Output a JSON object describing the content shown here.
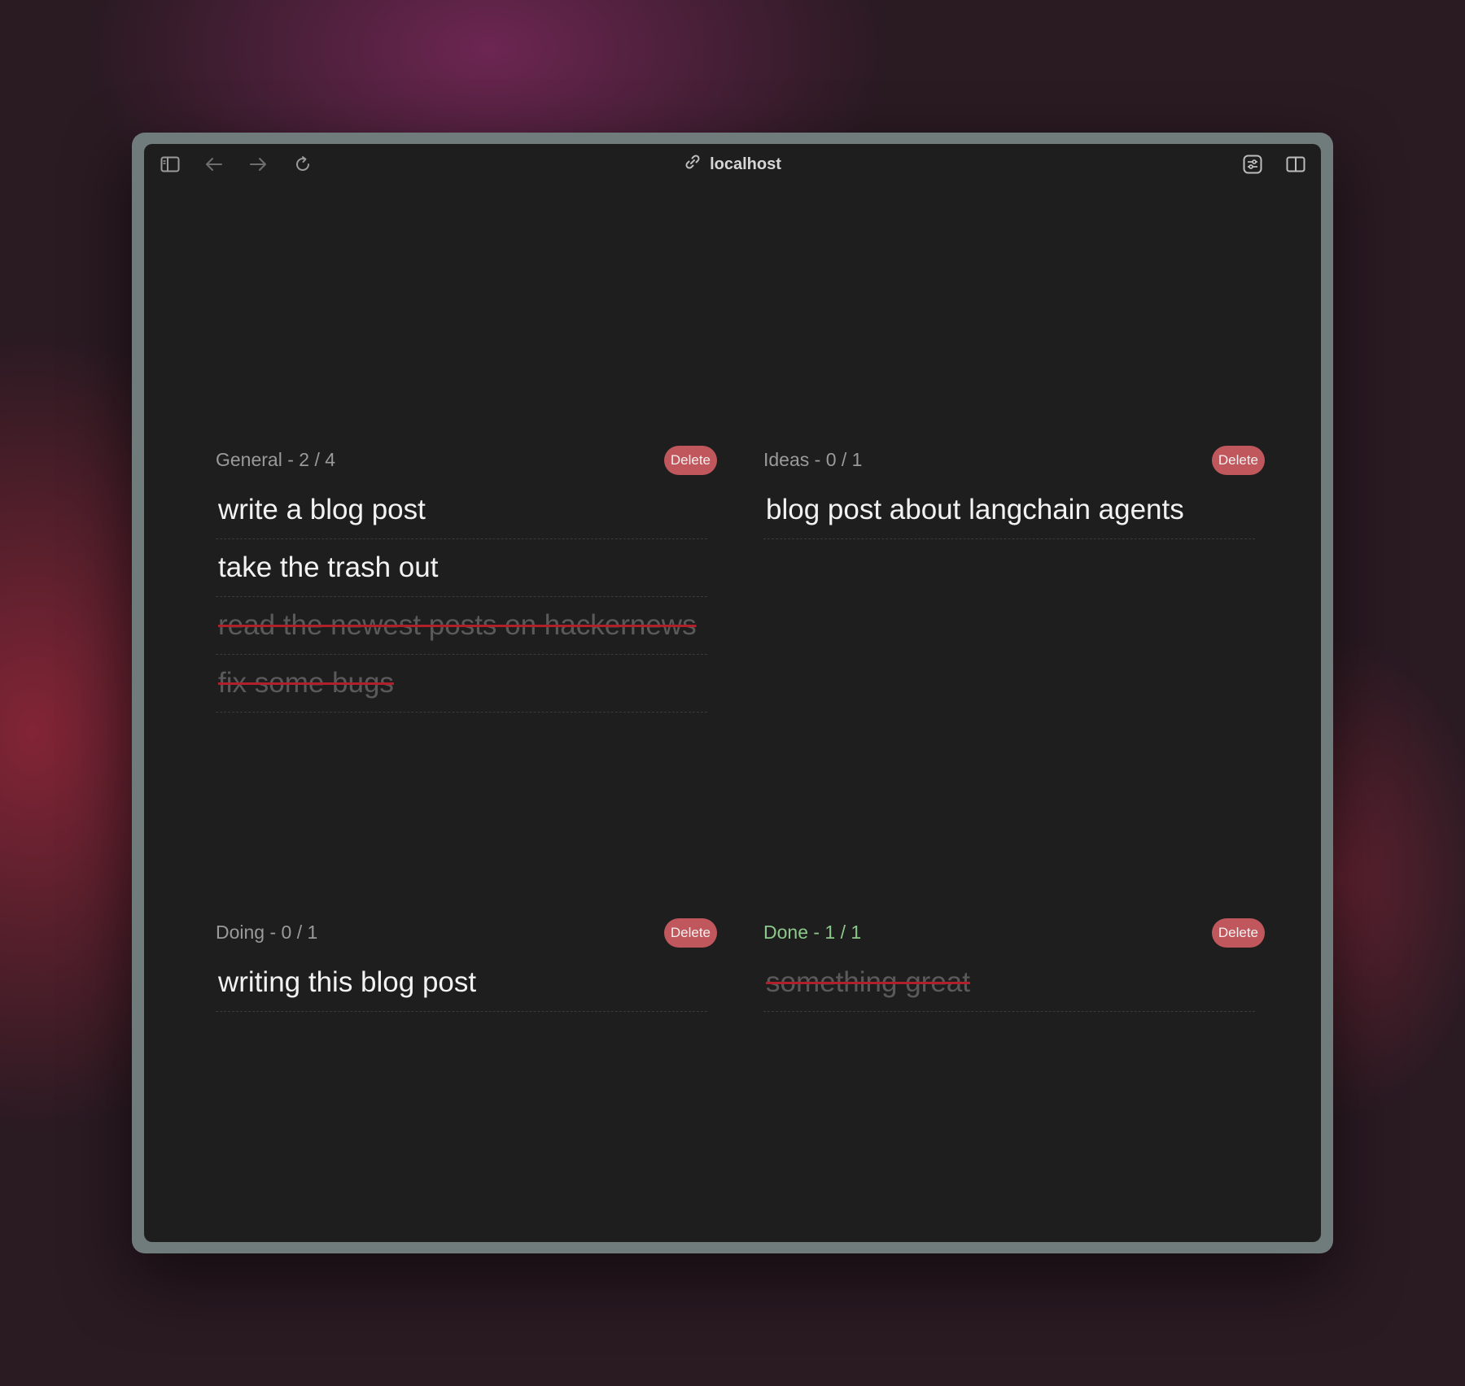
{
  "browser": {
    "url": "localhost",
    "icons": {
      "sidebar": "sidebar-toggle-icon",
      "back": "arrow-left-icon",
      "forward": "arrow-right-icon",
      "reload": "reload-icon",
      "link": "link-icon",
      "extensions": "sliders-icon",
      "split": "split-view-icon"
    }
  },
  "colors": {
    "background": "#1e1e1e",
    "delete_button": "#c0575d",
    "done_title": "#8cc88a",
    "strike": "#b0202a"
  },
  "columns": [
    {
      "title": "General - 2 / 4",
      "delete_label": "Delete",
      "tasks": [
        {
          "text": "write a blog post",
          "done": false
        },
        {
          "text": "take the trash out",
          "done": false
        },
        {
          "text": "read the newest posts on hackernews",
          "done": true
        },
        {
          "text": "fix some bugs",
          "done": true
        }
      ]
    },
    {
      "title": "Ideas - 0 / 1",
      "delete_label": "Delete",
      "tasks": [
        {
          "text": "blog post about langchain agents",
          "done": false
        }
      ]
    },
    {
      "title": "Doing - 0 / 1",
      "delete_label": "Delete",
      "tasks": [
        {
          "text": "writing this blog post",
          "done": false
        }
      ]
    },
    {
      "title": "Done - 1 / 1",
      "delete_label": "Delete",
      "tasks": [
        {
          "text": "something great",
          "done": true
        }
      ]
    }
  ]
}
